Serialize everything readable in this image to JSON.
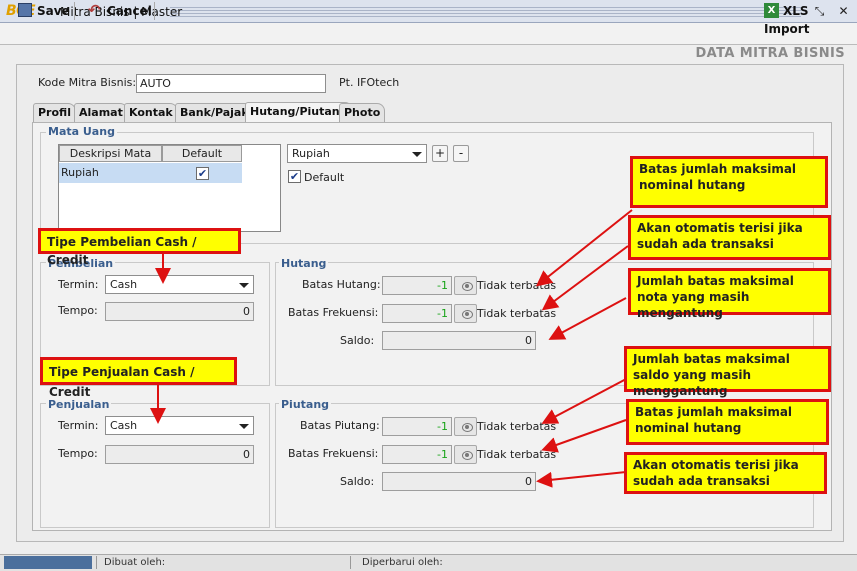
{
  "window": {
    "logo": "BCE",
    "title": "Mitra Bisnis | Master"
  },
  "toolbar": {
    "save": "Save",
    "cancel": "Cancel",
    "xls_import": "XLS Import"
  },
  "page_title": "DATA MITRA BISNIS",
  "header": {
    "kode_label": "Kode Mitra Bisnis:",
    "kode_value": "AUTO",
    "company": "Pt. IFOtech"
  },
  "tabs": [
    {
      "label": "Profil",
      "active": false
    },
    {
      "label": "Alamat",
      "active": false
    },
    {
      "label": "Kontak",
      "active": false
    },
    {
      "label": "Bank/Pajak",
      "active": false
    },
    {
      "label": "Hutang/Piutang",
      "active": true
    },
    {
      "label": "Photo",
      "active": false
    }
  ],
  "mata_uang": {
    "legend": "Mata Uang",
    "col_desc": "Deskripsi Mata Uang",
    "col_default": "Default",
    "rows": [
      {
        "desc": "Rupiah",
        "default": true
      }
    ],
    "selected": "Rupiah",
    "add": "+",
    "remove": "-",
    "default_label": "Default",
    "default_checked": true
  },
  "pembelian": {
    "legend": "Pembelian",
    "termin_label": "Termin:",
    "termin_value": "Cash",
    "tempo_label": "Tempo:",
    "tempo_value": "0"
  },
  "hutang": {
    "legend": "Hutang",
    "batas_label": "Batas Hutang:",
    "batas_value": "-1",
    "batas_note": "Tidak terbatas",
    "frek_label": "Batas Frekuensi:",
    "frek_value": "-1",
    "frek_note": "Tidak terbatas",
    "saldo_label": "Saldo:",
    "saldo_value": "0"
  },
  "penjualan": {
    "legend": "Penjualan",
    "termin_label": "Termin:",
    "termin_value": "Cash",
    "tempo_label": "Tempo:",
    "tempo_value": "0"
  },
  "piutang": {
    "legend": "Piutang",
    "batas_label": "Batas Piutang:",
    "batas_value": "-1",
    "batas_note": "Tidak terbatas",
    "frek_label": "Batas Frekuensi:",
    "frek_value": "-1",
    "frek_note": "Tidak terbatas",
    "saldo_label": "Saldo:",
    "saldo_value": "0"
  },
  "callouts": {
    "tipe_pembelian": "Tipe Pembelian Cash / Credit",
    "tipe_penjualan": "Tipe Penjualan Cash / Credit",
    "hutang_batas": "Batas jumlah maksimal nominal hutang",
    "hutang_saldo": "Akan otomatis terisi jika sudah ada transaksi",
    "hutang_frek": "Jumlah batas maksimal nota yang masih mengantung",
    "piutang_batas_saldo": "Jumlah batas maksimal saldo yang masih menggantung",
    "piutang_nominal": "Batas jumlah maksimal nominal hutang",
    "piutang_saldo": "Akan otomatis terisi jika sudah ada transaksi"
  },
  "status": {
    "dibuat": "Dibuat oleh:",
    "diperbarui": "Diperbarui oleh:"
  },
  "colors": {
    "callout_bg": "#ffff00",
    "callout_border": "#dd1111",
    "legend": "#3a5e8e",
    "value_green": "#19a319"
  }
}
